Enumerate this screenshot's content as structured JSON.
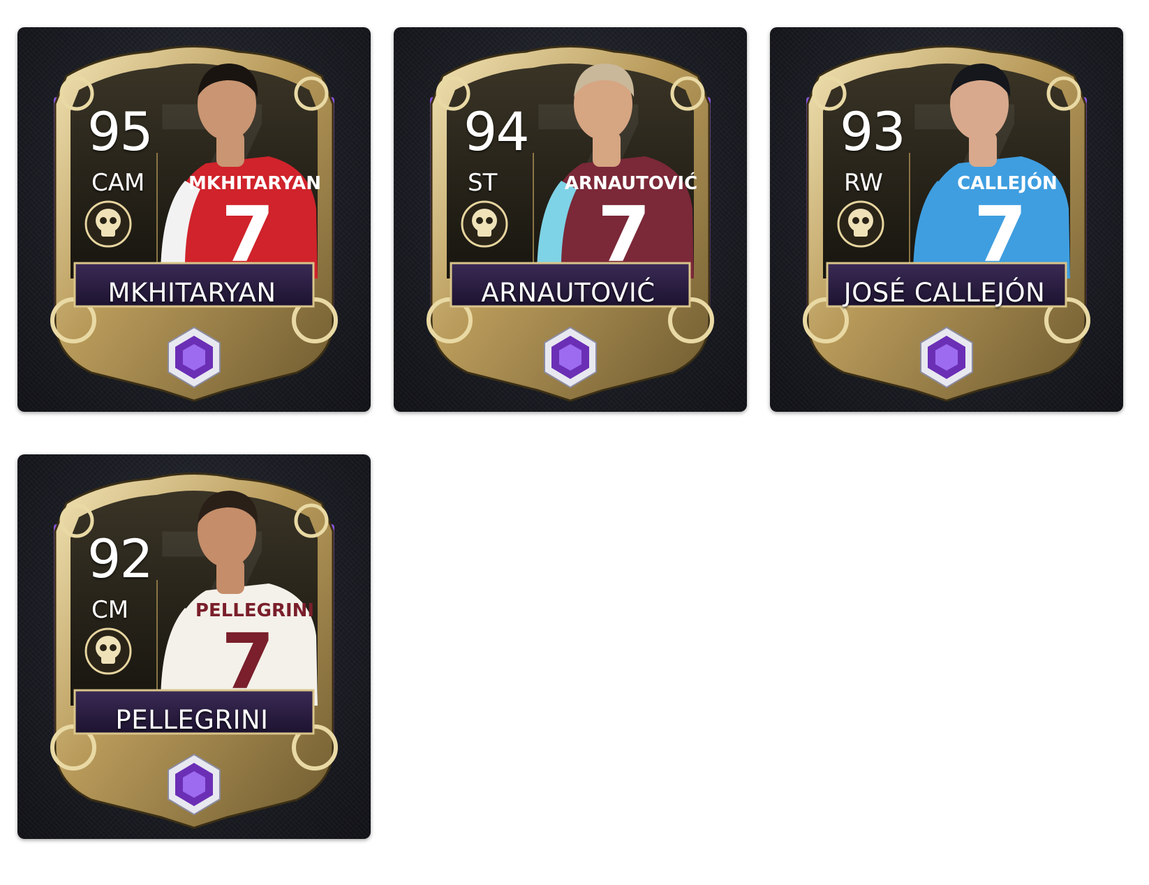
{
  "accent_colors": {
    "gold": "#c9b27a",
    "purple": "#6b2fb5",
    "tile_bg": "#1c1e25"
  },
  "cards": [
    {
      "rating": "95",
      "position": "CAM",
      "name": "MKHITARYAN",
      "shirt_name": "MKHITARYAN",
      "shirt_number": "7",
      "kit_colors": {
        "primary": "#d0232b",
        "sleeve": "#f2f2f2",
        "number": "#ffffff"
      },
      "hair_color": "#1a1410",
      "skin_color": "#c99572",
      "badge_icon": "skull-icon",
      "tier_icon": "purple-gem-icon"
    },
    {
      "rating": "94",
      "position": "ST",
      "name": "ARNAUTOVIĆ",
      "shirt_name": "ARNAUTOVIĆ",
      "shirt_number": "7",
      "kit_colors": {
        "primary": "#7b2838",
        "sleeve": "#7fd3e6",
        "number": "#ffffff"
      },
      "hair_color": "#c9b89a",
      "skin_color": "#d6a582",
      "badge_icon": "skull-icon",
      "tier_icon": "purple-gem-icon"
    },
    {
      "rating": "93",
      "position": "RW",
      "name": "JOSÉ CALLEJÓN",
      "shirt_name": "CALLEJÓN",
      "shirt_number": "7",
      "kit_colors": {
        "primary": "#3f9ee0",
        "sleeve": "#3f9ee0",
        "number": "#ffffff"
      },
      "hair_color": "#15171c",
      "skin_color": "#d8a98c",
      "badge_icon": "skull-icon",
      "tier_icon": "purple-gem-icon"
    },
    {
      "rating": "92",
      "position": "CM",
      "name": "PELLEGRINI",
      "shirt_name": "PELLEGRINI",
      "shirt_number": "7",
      "kit_colors": {
        "primary": "#f4f1ea",
        "sleeve": "#f4f1ea",
        "number": "#7a1f2b"
      },
      "hair_color": "#2a2018",
      "skin_color": "#c58d6a",
      "badge_icon": "skull-icon",
      "tier_icon": "purple-gem-icon"
    }
  ]
}
